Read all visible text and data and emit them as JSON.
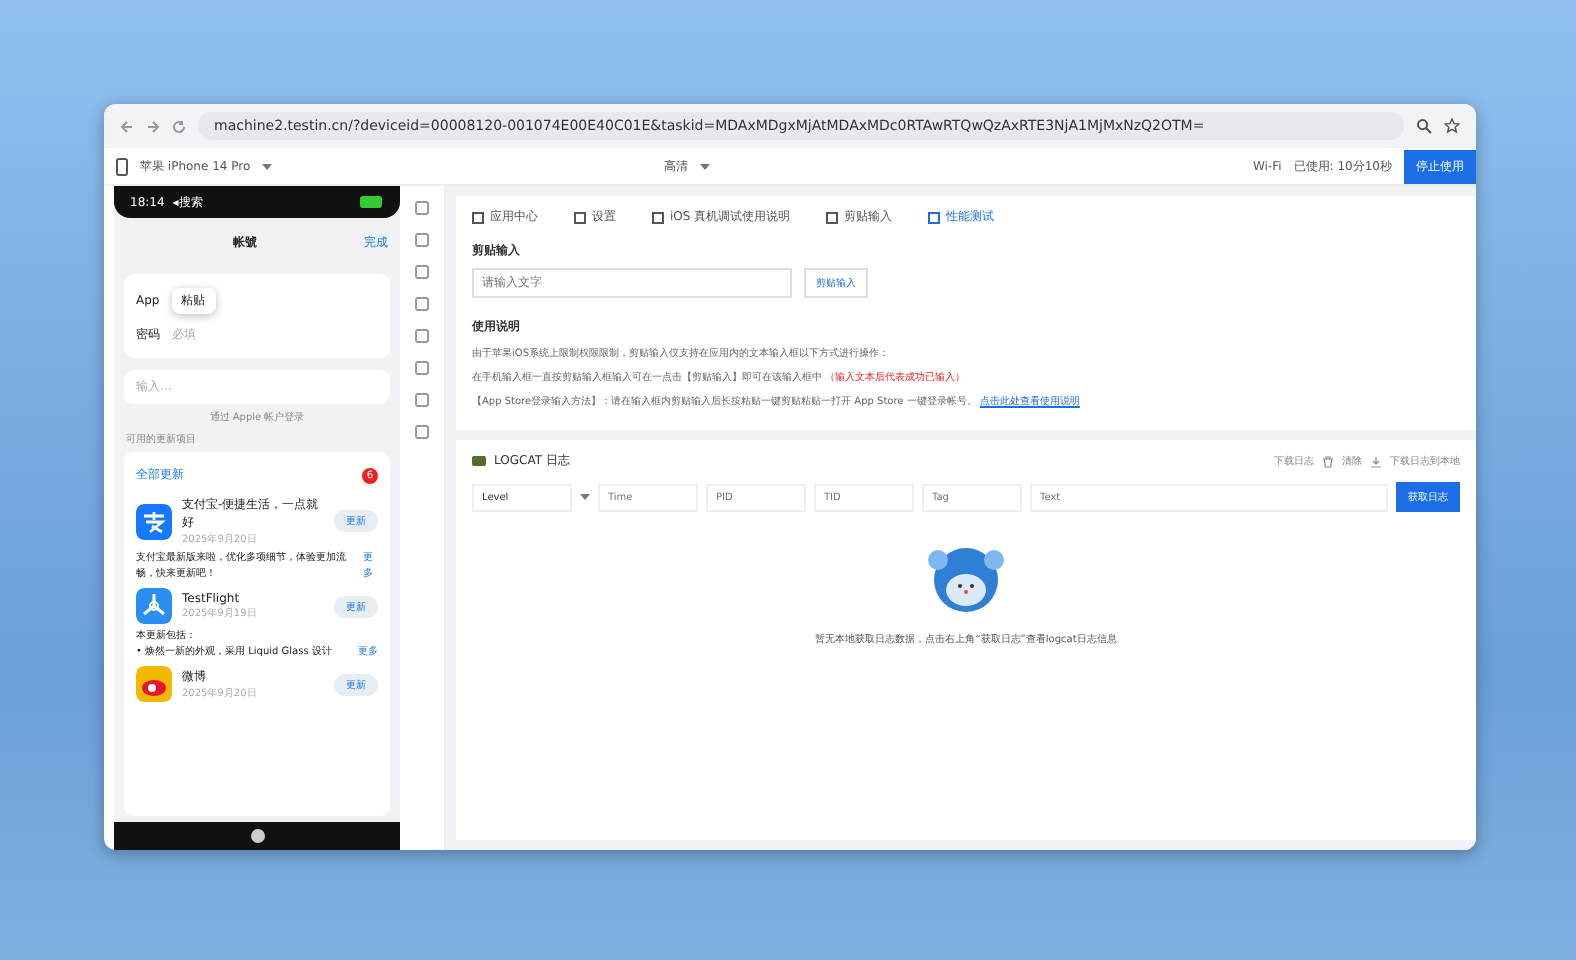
{
  "browser": {
    "url": "machine2.testin.cn/?deviceid=00008120-001074E00E40C01E&taskid=MDAxMDgxMjAtMDAxMDc0RTAwRTQwQzAxRTE3NjA1MjMxNzQ2OTM="
  },
  "toolbar": {
    "device": "苹果 iPhone 14 Pro",
    "quality": "高清",
    "network": "Wi-Fi",
    "elapsed": "已使用: 10分10秒",
    "stop_button": "停止使用"
  },
  "phone": {
    "time": "18:14",
    "back": "◂搜索",
    "title": "帐號",
    "done": "完成",
    "app_label": "App",
    "paste_popup": "粘贴",
    "password_label": "密码",
    "password_placeholder": "必填",
    "search_placeholder": "输入...",
    "apple_link": "通过 Apple 帐户登录",
    "section": "可用的更新项目",
    "update_all": "全部更新",
    "badge": "6",
    "apps": [
      {
        "kind": "alipay",
        "name": "支付宝-便捷生活，一点就好",
        "date": "2025年9月20日",
        "button": "更新",
        "note": "支付宝最新版来啦，优化多项细节，体验更加流畅，快来更新吧！",
        "more": "更多"
      },
      {
        "kind": "testflight",
        "name": "TestFlight",
        "date": "2025年9月19日",
        "button": "更新",
        "note": "本更新包括：\n• 焕然一新的外观，采用 Liquid Glass 设计",
        "more": "更多"
      },
      {
        "kind": "weibo",
        "name": "微博",
        "date": "2025年9月20日",
        "button": "更新"
      }
    ]
  },
  "tabs": [
    {
      "label": "应用中心",
      "selected": false
    },
    {
      "label": "设置",
      "selected": false
    },
    {
      "label": "iOS 真机调试使用说明",
      "selected": false
    },
    {
      "label": "剪贴输入",
      "selected": false
    },
    {
      "label": "性能测试",
      "selected": true
    }
  ],
  "clipboard": {
    "title": "剪贴输入",
    "placeholder": "请输入文字",
    "button": "剪贴输入",
    "help_title": "使用说明",
    "help": [
      "由于苹果iOS系统上限制权限限制，剪贴输入仅支持在应用内的文本输入框以下方式进行操作：",
      "在手机输入框一直按剪贴输入框输入可在一点击【剪贴输入】即可在该输入框中 **（输入文本后代表成功已输入）**",
      "【App Store登录输入方法】：请在输入框内剪贴输入后长按粘贴一键剪贴粘贴一打开 App Store 一键登录帐号。"
    ],
    "link": "点击此处查看使用说明"
  },
  "logcat": {
    "title": "LOGCAT 日志",
    "download": "下载日志",
    "clear": "清除",
    "save": "下载日志到本地",
    "level": "Level",
    "filters": [
      {
        "placeholder": "Time"
      },
      {
        "placeholder": "PID"
      },
      {
        "placeholder": "TID"
      },
      {
        "placeholder": "Tag"
      },
      {
        "placeholder": "Text"
      }
    ],
    "fetch_button": "获取日志",
    "empty": "暂无本地获取日志数据，点击右上角“获取日志”查看logcat日志信息"
  }
}
